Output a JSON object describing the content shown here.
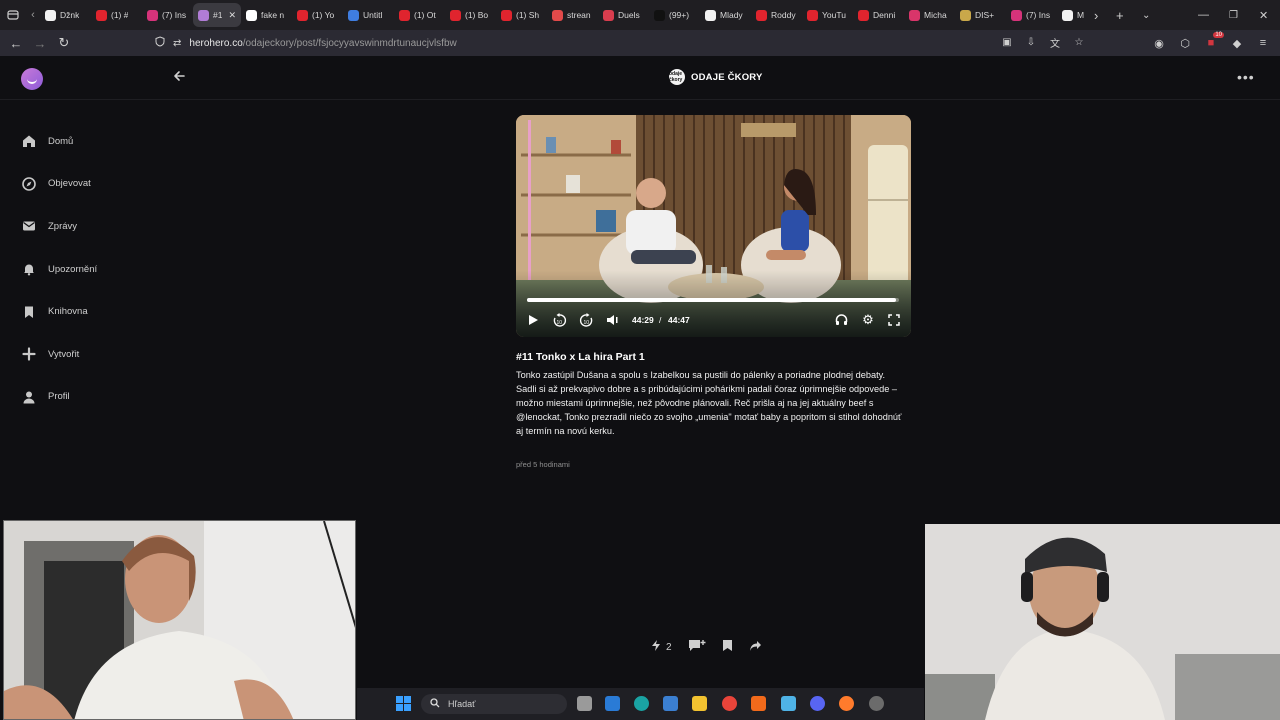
{
  "browser": {
    "tabs": [
      {
        "title": "Džnk",
        "color": "#f2f2f2",
        "active": false
      },
      {
        "title": "(1) #",
        "color": "#e0242e",
        "active": false
      },
      {
        "title": "(7) Ins",
        "color": "#d6337a",
        "active": false
      },
      {
        "title": "#1",
        "color": "#b07cd6",
        "active": true
      },
      {
        "title": "fake n",
        "color": "#ffffff",
        "active": false
      },
      {
        "title": "(1) Yo",
        "color": "#e0242e",
        "active": false
      },
      {
        "title": "Untitl",
        "color": "#3f7de0",
        "active": false
      },
      {
        "title": "(1) Ot",
        "color": "#e0242e",
        "active": false
      },
      {
        "title": "(1) Bo",
        "color": "#e0242e",
        "active": false
      },
      {
        "title": "(1) Sh",
        "color": "#e0242e",
        "active": false
      },
      {
        "title": "strean",
        "color": "#e24a4a",
        "active": false
      },
      {
        "title": "Duels",
        "color": "#d93d4e",
        "active": false
      },
      {
        "title": "(99+)",
        "color": "#111111",
        "active": false
      },
      {
        "title": "Mlady",
        "color": "#f2f2f2",
        "active": false
      },
      {
        "title": "Roddy",
        "color": "#e0242e",
        "active": false
      },
      {
        "title": "YouTu",
        "color": "#e0242e",
        "active": false
      },
      {
        "title": "Denni",
        "color": "#e0242e",
        "active": false
      },
      {
        "title": "Micha",
        "color": "#d9356a",
        "active": false
      },
      {
        "title": "DIS+",
        "color": "#c9a84a",
        "active": false
      },
      {
        "title": "(7) Ins",
        "color": "#d6337a",
        "active": false
      },
      {
        "title": "M",
        "color": "#f2f2f2",
        "active": false
      }
    ],
    "url_host": "herohero.co",
    "url_path": "/odajeckory/post/fsjocyyavswinmdrtunaucjvlsfbw",
    "extension_badge": "10"
  },
  "header": {
    "creator_name": "ODAJE ČKORY",
    "creator_avatar_text": "odaje čkory"
  },
  "nav": {
    "items": [
      {
        "label": "Domů",
        "icon": "home-icon"
      },
      {
        "label": "Objevovat",
        "icon": "compass-icon"
      },
      {
        "label": "Zprávy",
        "icon": "mail-icon"
      },
      {
        "label": "Upozornění",
        "icon": "bell-icon"
      },
      {
        "label": "Knihovna",
        "icon": "bookmark-icon"
      },
      {
        "label": "Vytvořit",
        "icon": "plus-icon"
      },
      {
        "label": "Profil",
        "icon": "user-icon"
      }
    ]
  },
  "player": {
    "current_time": "44:29",
    "separator": "/",
    "duration": "44:47",
    "progress": 0.993
  },
  "post": {
    "title": "#11 Tonko x La hira Part 1",
    "paragraph1": "Tonko zastúpil Dušana a spolu s Izabelkou sa pustili do pálenky a poriadne plodnej debaty.",
    "paragraph2": "Sadli si až prekvapivo dobre a s pribúdajúcimi pohárikmi padali čoraz úprimnejšie odpovede – možno miestami úprimnejšie, než pôvodne plánovali. Reč prišla aj na jej aktuálny beef s @lenockat, Tonko prezradil niečo zo svojho „umenia\" motať baby a popritom si stihol dohodnúť aj termín na novú kerku.",
    "time_ago": "před 5 hodinami"
  },
  "actions": {
    "likes": "2"
  },
  "taskbar": {
    "search_placeholder": "Hľadať"
  },
  "colors": {
    "page_bg": "#0f0f12",
    "accent": "#b07cd6"
  }
}
